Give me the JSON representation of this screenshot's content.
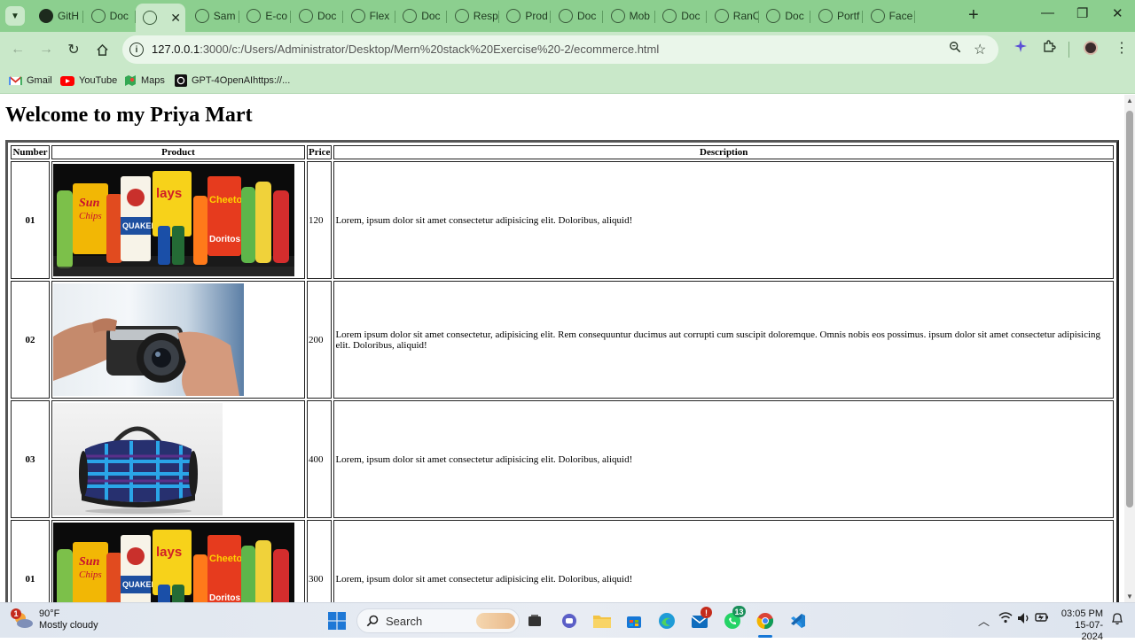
{
  "browser": {
    "tabs": [
      {
        "label": "GitH",
        "icon": "github-icon"
      },
      {
        "label": "Doc",
        "icon": "globe-icon"
      },
      {
        "label": "",
        "icon": "globe-icon",
        "active": true
      },
      {
        "label": "Sam",
        "icon": "globe-icon"
      },
      {
        "label": "E-co",
        "icon": "globe-icon"
      },
      {
        "label": "Doc",
        "icon": "globe-icon"
      },
      {
        "label": "Flex",
        "icon": "globe-icon"
      },
      {
        "label": "Doc",
        "icon": "globe-icon"
      },
      {
        "label": "Resp",
        "icon": "globe-icon"
      },
      {
        "label": "Prod",
        "icon": "globe-icon"
      },
      {
        "label": "Doc",
        "icon": "globe-icon"
      },
      {
        "label": "Mob",
        "icon": "globe-icon"
      },
      {
        "label": "Doc",
        "icon": "globe-icon"
      },
      {
        "label": "RanC",
        "icon": "globe-icon"
      },
      {
        "label": "Doc",
        "icon": "globe-icon"
      },
      {
        "label": "Portf",
        "icon": "globe-icon"
      },
      {
        "label": "Face",
        "icon": "globe-icon"
      }
    ],
    "url_host": "127.0.0.1",
    "url_path": ":3000/c:/Users/Administrator/Desktop/Mern%20stack%20Exercise%20-2/ecommerce.html",
    "bookmarks": [
      {
        "label": "Gmail",
        "icon": "gmail-icon"
      },
      {
        "label": "YouTube",
        "icon": "youtube-icon"
      },
      {
        "label": "Maps",
        "icon": "maps-icon"
      },
      {
        "label": "GPT-4OpenAIhttps://...",
        "icon": "chatgpt-icon"
      }
    ],
    "theme_color": "#8ccf8f",
    "toolbar_color": "#c9e8c9"
  },
  "page": {
    "title": "Welcome to my Priya Mart",
    "table": {
      "headers": [
        "Number",
        "Product",
        "Price",
        "Description"
      ],
      "rows": [
        {
          "number": "01",
          "product_image": "snacks-and-drinks-image",
          "price": "120",
          "description": "Lorem, ipsum dolor sit amet consectetur adipisicing elit. Doloribus, aliquid!"
        },
        {
          "number": "02",
          "product_image": "camera-image",
          "price": "200",
          "description": "Lorem ipsum dolor sit amet consectetur, adipisicing elit. Rem consequuntur ducimus aut corrupti cum suscipit doloremque. Omnis nobis eos possimus. ipsum dolor sit amet consectetur adipisicing elit. Doloribus, aliquid!"
        },
        {
          "number": "03",
          "product_image": "duffel-bag-image",
          "price": "400",
          "description": "Lorem, ipsum dolor sit amet consectetur adipisicing elit. Doloribus, aliquid!"
        },
        {
          "number": "01",
          "product_image": "snacks-and-drinks-image",
          "price": "300",
          "description": "Lorem, ipsum dolor sit amet consectetur adipisicing elit. Doloribus, aliquid!"
        }
      ]
    }
  },
  "taskbar": {
    "weather_temp": "90°F",
    "weather_desc": "Mostly cloudy",
    "weather_badge": "1",
    "search_label": "Search",
    "mail_badge": "!",
    "whatsapp_badge": "13",
    "time": "03:05 PM",
    "date": "15-07-2024"
  }
}
